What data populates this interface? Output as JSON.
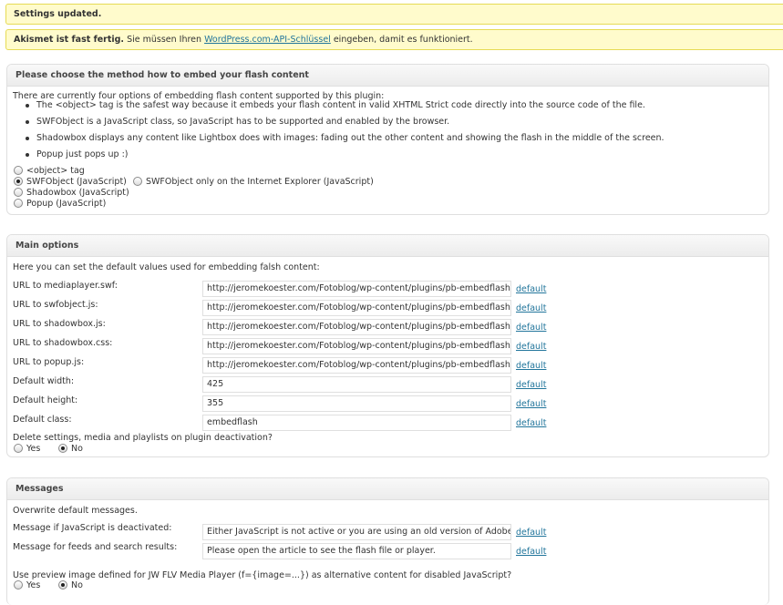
{
  "notices": {
    "updated": "Settings updated.",
    "akismet_bold": "Akismet ist fast fertig.",
    "akismet_text_before": " Sie müssen Ihren ",
    "akismet_link": "WordPress.com-API-Schlüssel",
    "akismet_text_after": " eingeben, damit es funktioniert."
  },
  "embed": {
    "title": "Please choose the method how to embed your flash content",
    "intro": "There are currently four options of embedding flash content supported by this plugin:",
    "bullets": [
      "The <object> tag is the safest way because it embeds your flash content in valid XHTML Strict code directly into the source code of the file.",
      "SWFObject is a JavaScript class, so JavaScript has to be supported and enabled by the browser.",
      "Shadowbox displays any content like Lightbox does with images: fading out the other content and showing the flash in the middle of the screen.",
      "Popup just pops up :)"
    ],
    "radios": [
      {
        "label": "<object> tag",
        "checked": false
      },
      {
        "label": "SWFObject (JavaScript)",
        "checked": true
      },
      {
        "label": "Shadowbox (JavaScript)",
        "checked": false
      },
      {
        "label": "Popup (JavaScript)",
        "checked": false
      }
    ],
    "ie_only_label": "SWFObject only on the Internet Explorer (JavaScript)",
    "ie_only_checked": false
  },
  "main": {
    "title": "Main options",
    "intro": "Here you can set the default values used for embedding falsh content:",
    "fields": [
      {
        "label": "URL to mediaplayer.swf:",
        "value": "http://jeromekoester.com/Fotoblog/wp-content/plugins/pb-embedflash/"
      },
      {
        "label": "URL to swfobject.js:",
        "value": "http://jeromekoester.com/Fotoblog/wp-content/plugins/pb-embedflash/"
      },
      {
        "label": "URL to shadowbox.js:",
        "value": "http://jeromekoester.com/Fotoblog/wp-content/plugins/pb-embedflash/"
      },
      {
        "label": "URL to shadowbox.css:",
        "value": "http://jeromekoester.com/Fotoblog/wp-content/plugins/pb-embedflash/"
      },
      {
        "label": "URL to popup.js:",
        "value": "http://jeromekoester.com/Fotoblog/wp-content/plugins/pb-embedflash/"
      },
      {
        "label": "Default width:",
        "value": "425"
      },
      {
        "label": "Default height:",
        "value": "355"
      },
      {
        "label": "Default class:",
        "value": "embedflash"
      }
    ],
    "default_link": "default",
    "delete_question": "Delete settings, media and playlists on plugin deactivation?",
    "yes": "Yes",
    "no": "No",
    "delete_value": "No"
  },
  "messages": {
    "title": "Messages",
    "intro": "Overwrite default messages.",
    "fields": [
      {
        "label": "Message if JavaScript is deactivated:",
        "value": "Either JavaScript is not active or you are using an old version of Adobe Flash Player."
      },
      {
        "label": "Message for feeds and search results:",
        "value": "Please open the article to see the flash file or player."
      }
    ],
    "preview_question": "Use preview image defined for JW FLV Media Player (f={image=...}) as alternative content for disabled JavaScript?",
    "yes": "Yes",
    "no": "No",
    "preview_value": "No"
  }
}
